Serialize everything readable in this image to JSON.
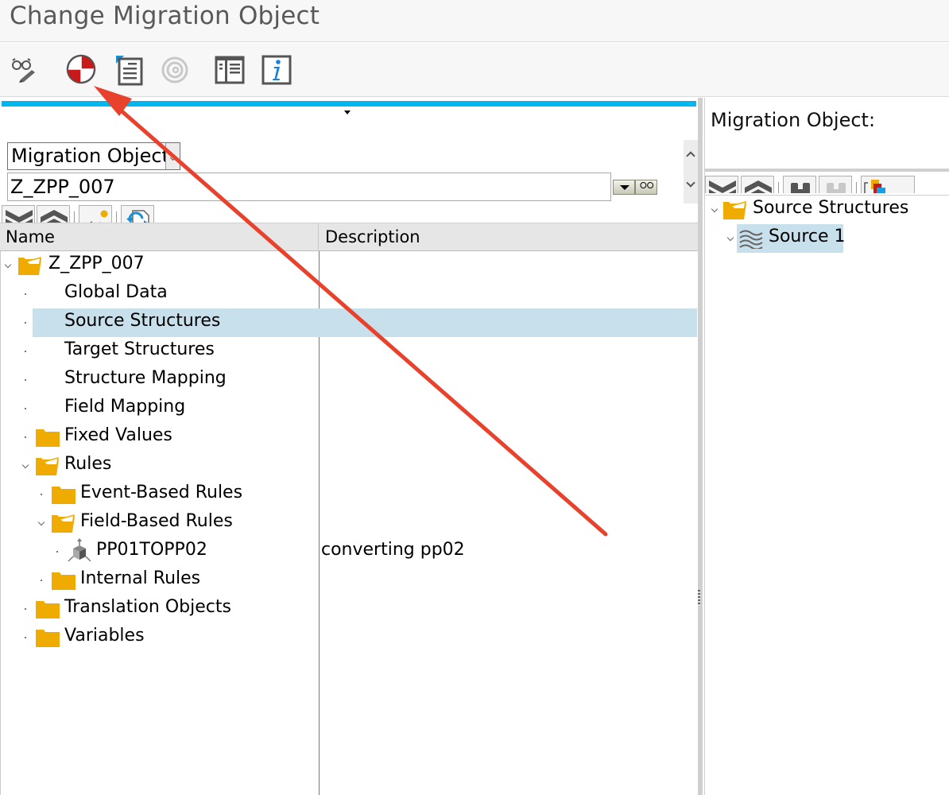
{
  "window": {
    "title": "Change Migration Object"
  },
  "app_toolbar": {
    "buttons": [
      {
        "name": "display-change-toggle",
        "icon": "glasses-pencil-icon"
      },
      {
        "name": "check-consistency",
        "icon": "lifebuoy-icon"
      },
      {
        "name": "document",
        "icon": "document-icon"
      },
      {
        "name": "spiral-disabled",
        "icon": "spiral-icon"
      },
      {
        "name": "tree-layout",
        "icon": "layout-panel-icon"
      },
      {
        "name": "information",
        "icon": "info-icon"
      }
    ]
  },
  "left_pane": {
    "object_type_select": {
      "value": "Migration Object"
    },
    "object_input": {
      "value": "Z_ZPP_007"
    },
    "tree_toolbar": [
      "expand-all-icon",
      "collapse-all-icon",
      "picture-icon",
      "refresh-icon"
    ],
    "columns": {
      "name": "Name",
      "description": "Description"
    },
    "rows": [
      {
        "label": "Z_ZPP_007",
        "description": "",
        "level": 0,
        "expander": "open",
        "icon": "folder-open"
      },
      {
        "label": "Global Data",
        "description": "",
        "level": 1,
        "expander": "leaf",
        "icon": "none"
      },
      {
        "label": "Source Structures",
        "description": "",
        "level": 1,
        "expander": "leaf",
        "icon": "none",
        "selected": true
      },
      {
        "label": "Target Structures",
        "description": "",
        "level": 1,
        "expander": "leaf",
        "icon": "none"
      },
      {
        "label": "Structure Mapping",
        "description": "",
        "level": 1,
        "expander": "leaf",
        "icon": "none"
      },
      {
        "label": "Field Mapping",
        "description": "",
        "level": 1,
        "expander": "leaf",
        "icon": "none"
      },
      {
        "label": "Fixed Values",
        "description": "",
        "level": 1,
        "expander": "leaf",
        "icon": "folder"
      },
      {
        "label": "Rules",
        "description": "",
        "level": 1,
        "expander": "open",
        "icon": "folder-open"
      },
      {
        "label": "Event-Based Rules",
        "description": "",
        "level": 2,
        "expander": "leaf",
        "icon": "folder"
      },
      {
        "label": "Field-Based Rules",
        "description": "",
        "level": 2,
        "expander": "open",
        "icon": "folder-open"
      },
      {
        "label": "PP01TOPP02",
        "description": "converting pp02",
        "level": 3,
        "expander": "leaf",
        "icon": "rule-cube"
      },
      {
        "label": "Internal Rules",
        "description": "",
        "level": 2,
        "expander": "leaf",
        "icon": "folder"
      },
      {
        "label": "Translation Objects",
        "description": "",
        "level": 1,
        "expander": "leaf",
        "icon": "folder"
      },
      {
        "label": "Variables",
        "description": "",
        "level": 1,
        "expander": "leaf",
        "icon": "folder"
      }
    ]
  },
  "right_pane": {
    "label": "Migration Object:",
    "toolbar": [
      "expand-all-icon",
      "collapse-all-icon",
      "find-icon",
      "find-next-icon",
      "color-legend-icon"
    ],
    "tree": [
      {
        "label": "Source Structures",
        "icon": "folder-open",
        "expander": "open"
      },
      {
        "label": "Source 1",
        "icon": "structure-waves",
        "expander": "open",
        "selected": true
      }
    ]
  },
  "colors": {
    "accent_blue": "#00b6ef",
    "selection": "#c8dfec",
    "folder": "#f0ab00",
    "annotation_arrow": "#e8412c"
  }
}
